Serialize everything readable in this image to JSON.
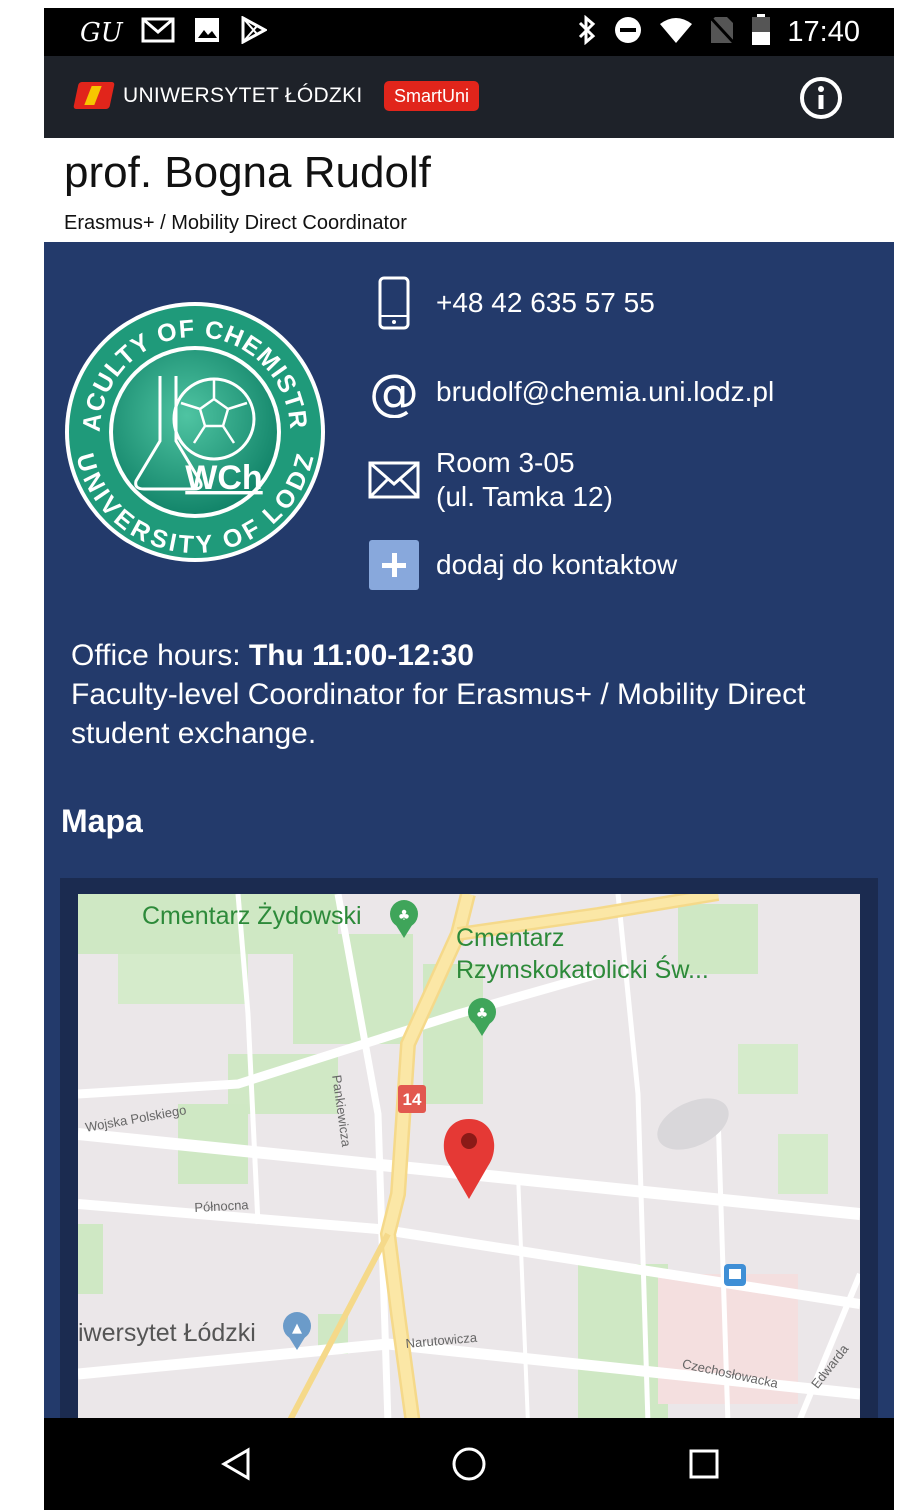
{
  "status_bar": {
    "left_icons": [
      "gu-icon",
      "gmail-icon",
      "image-icon",
      "play-store-icon"
    ],
    "gu_text": "GU",
    "right_icons": [
      "bluetooth-icon",
      "do-not-disturb-icon",
      "wifi-icon",
      "no-sim-icon",
      "battery-icon"
    ],
    "time": "17:40"
  },
  "app_bar": {
    "university_name": "UNIWERSYTET ŁÓDZKI",
    "badge": "SmartUni",
    "info_icon": "info-icon",
    "colors": {
      "brand_red": "#e1251b",
      "brand_yellow": "#f7c600",
      "bar_bg": "#1e2229"
    }
  },
  "header": {
    "name": "prof. Bogna Rudolf",
    "role": "Erasmus+ / Mobility Direct Coordinator"
  },
  "faculty_logo": {
    "top_text": "FACULTY OF CHEMISTRY",
    "bottom_text": "UNIVERSITY OF LODZ",
    "center_text": "WCh",
    "color": "#1f9a7a"
  },
  "contacts": {
    "phone": "+48 42 635 57 55",
    "email": "brudolf@chemia.uni.lodz.pl",
    "room_line1": "Room 3-05",
    "room_line2": "(ul. Tamka 12)",
    "add_contact": "dodaj do kontaktow"
  },
  "office": {
    "hours_label": "Office hours:",
    "hours_value": "Thu 11:00-12:30",
    "description": "Faculty-level Coordinator for Erasmus+ / Mobility Direct student exchange."
  },
  "map_section": {
    "title": "Mapa",
    "labels": {
      "cemetery_jewish": "Cmentarz Żydowski",
      "cemetery_catholic_1": "Cmentarz",
      "cemetery_catholic_2": "Rzymskokatolicki Św...",
      "university": "iwersytet Łódzki",
      "route": "14"
    },
    "streets": {
      "pankiewicza": "Pankiewicza",
      "wojska": "Wojska Polskiego",
      "polnocna": "Północna",
      "narutowicza": "Narutowicza",
      "czechoslowacka": "Czechosłowacka",
      "edwarda": "Edwarda"
    }
  },
  "nav_bar": {
    "back": "back-icon",
    "home": "home-icon",
    "recents": "recents-icon"
  },
  "theme": {
    "content_bg": "#233a6b",
    "header_bg": "#ffffff"
  }
}
